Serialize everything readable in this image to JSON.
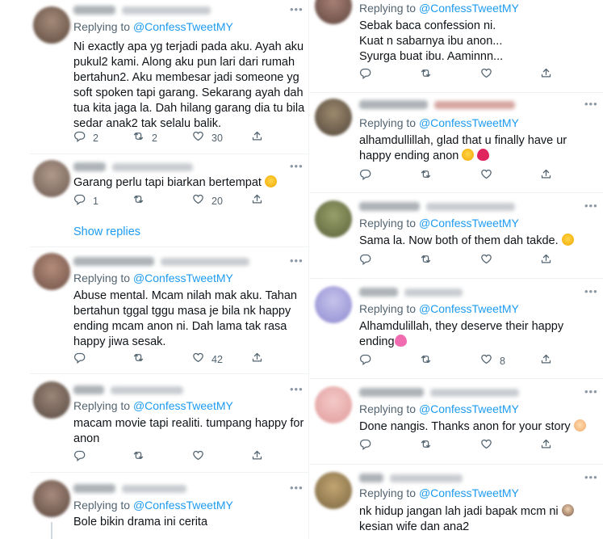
{
  "icons": [
    "reply-icon",
    "retweet-icon",
    "like-icon",
    "share-icon",
    "more-icon"
  ],
  "colors": {
    "mention": "#1d9bf0",
    "secondary_text": "#536471",
    "primary_text": "#0f1419",
    "divider": "#eff3f4"
  },
  "left_tweets": [
    {
      "replying_prefix": "Replying to",
      "mention": "@ConfessTweetMY",
      "lines": [
        "Ni exactly apa yg terjadi pada aku. Ayah aku",
        "pukul2 kami. Along aku pun lari dari rumah",
        "bertahun2. Aku membesar jadi someone yg",
        "soft spoken tapi garang. Sekarang ayah dah",
        "tua kita jaga la. Dah hilang garang dia tu bila",
        "sedar anak2 tak selalu balik."
      ],
      "replies": "2",
      "retweets": "2",
      "likes": "30"
    },
    {
      "lines": [
        "Garang perlu tapi biarkan bertempat"
      ],
      "emoji": "smiling-face-emoji",
      "replies": "1",
      "retweets": "",
      "likes": "20",
      "show_replies": "Show replies"
    },
    {
      "replying_prefix": "Replying to",
      "mention": "@ConfessTweetMY",
      "lines": [
        "Abuse mental. Mcam nilah mak aku. Tahan",
        "bertahun tggal tggu masa je bila nk happy",
        "ending mcam anon ni. Dah lama tak rasa",
        "happy jiwa sesak."
      ],
      "replies": "",
      "retweets": "",
      "likes": "42"
    },
    {
      "replying_prefix": "Replying to",
      "mention": "@ConfessTweetMY",
      "lines": [
        "macam movie tapi realiti. tumpang happy for",
        "anon"
      ],
      "replies": "",
      "retweets": "",
      "likes": ""
    },
    {
      "replying_prefix": "Replying to",
      "mention": "@ConfessTweetMY",
      "lines": [
        "Bole bikin drama ini cerita"
      ]
    }
  ],
  "right_tweets": [
    {
      "replying_prefix": "Replying to",
      "mention": "@ConfessTweetMY",
      "lines": [
        "Sebak baca confession ni.",
        "Kuat n sabarnya ibu anon...",
        "Syurga buat ibu. Aaminnn..."
      ],
      "replies": "",
      "retweets": "",
      "likes": ""
    },
    {
      "replying_prefix": "Replying to",
      "mention": "@ConfessTweetMY",
      "lines": [
        "alhamdullillah, glad that u finally have ur",
        "happy ending anon"
      ],
      "emoji": "pleading-face-and-red-heart-emoji",
      "replies": "",
      "retweets": "",
      "likes": ""
    },
    {
      "replying_prefix": "Replying to",
      "mention": "@ConfessTweetMY",
      "lines": [
        "Sama la. Now both of them dah takde."
      ],
      "emoji": "crying-face-emoji",
      "replies": "",
      "retweets": "",
      "likes": ""
    },
    {
      "replying_prefix": "Replying to",
      "mention": "@ConfessTweetMY",
      "lines": [
        "Alhamdulillah, they deserve their happy",
        "ending"
      ],
      "emoji": "two-hearts-emoji",
      "replies": "",
      "retweets": "",
      "likes": "8"
    },
    {
      "replying_prefix": "Replying to",
      "mention": "@ConfessTweetMY",
      "lines": [
        "Done nangis. Thanks anon for your story"
      ],
      "emoji": "heart-hands-emoji",
      "replies": "",
      "retweets": "",
      "likes": ""
    },
    {
      "replying_prefix": "Replying to",
      "mention": "@ConfessTweetMY",
      "lines": [
        "nk hidup jangan lah jadi bapak mcm ni",
        "kesian wife dan ana2"
      ],
      "emoji": "facepalm-emoji"
    }
  ]
}
